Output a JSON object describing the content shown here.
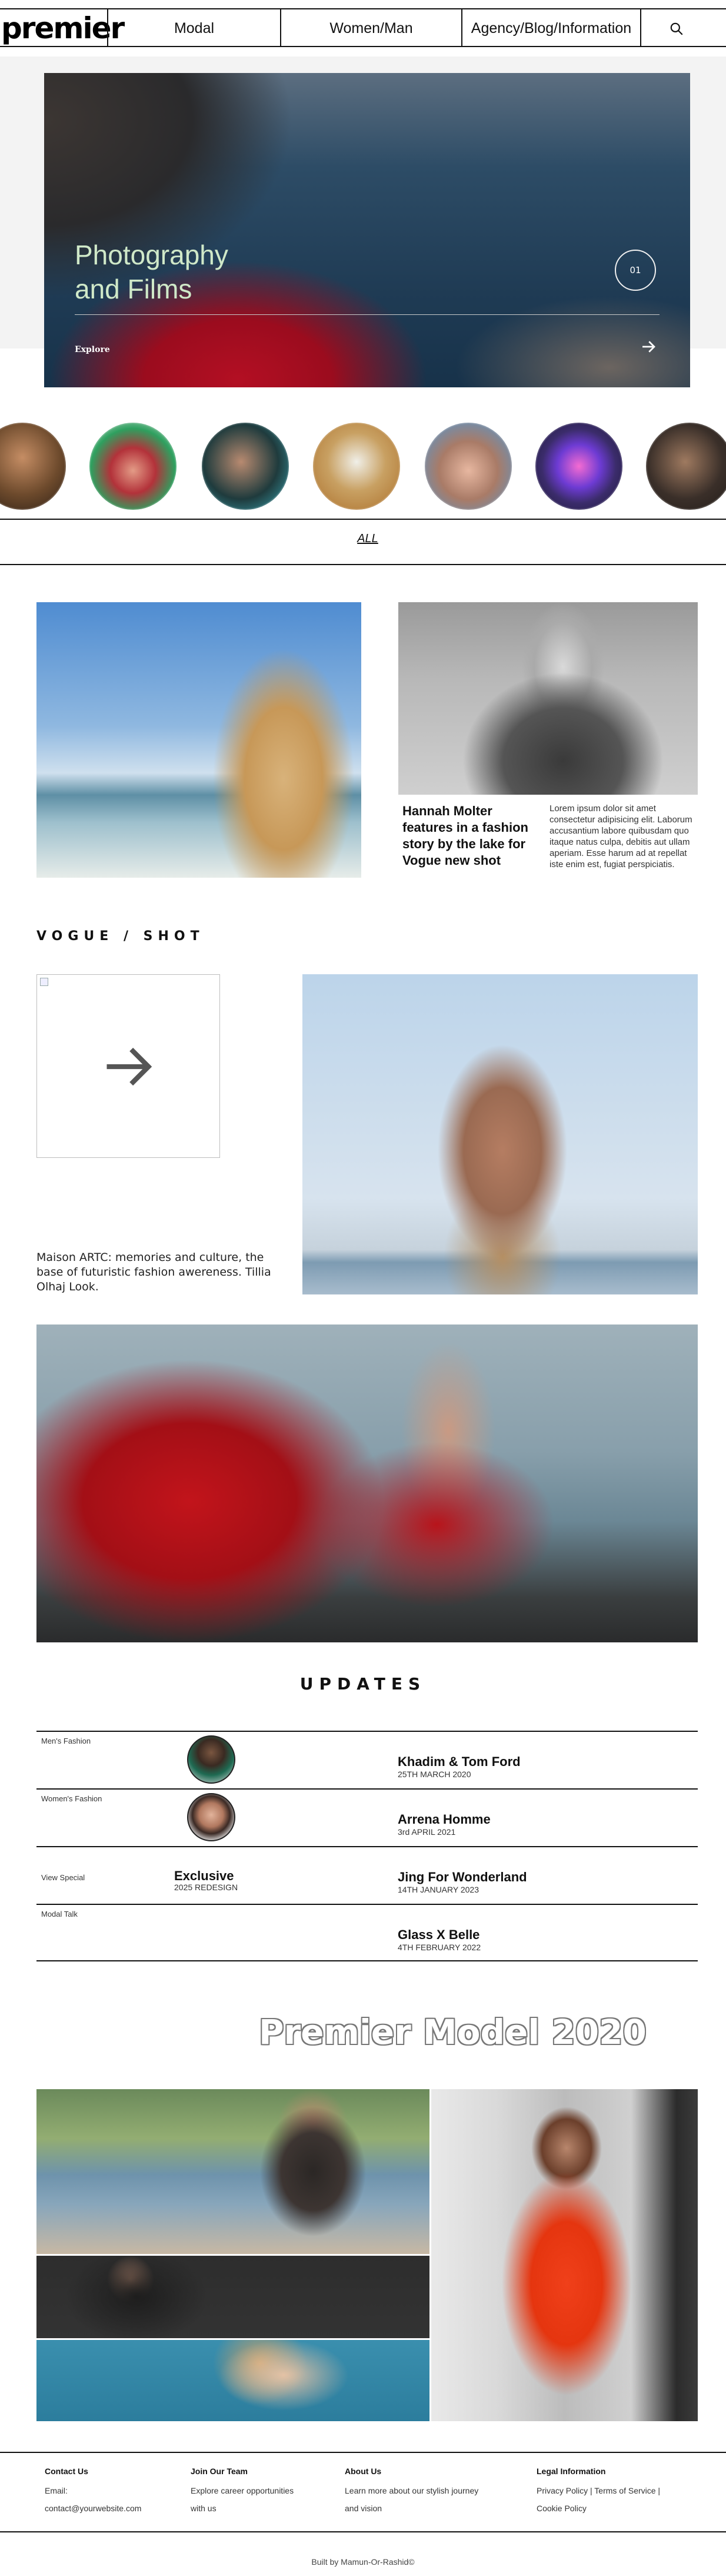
{
  "nav": {
    "logo": "premier",
    "links": [
      "Modal",
      "Women/Man",
      "Agency/Blog/Information"
    ],
    "search_icon": "search-icon"
  },
  "hero": {
    "title_line1": "Photography",
    "title_line2": "and Films",
    "counter": "01",
    "explore": "Explore",
    "arrow_icon": "arrow-right-icon"
  },
  "avatars": {
    "count": 7,
    "tones": [
      "#6d4a2c",
      "#2ea05f",
      "#2b6c73",
      "#b6813f",
      "#a97b67",
      "#3b2c6b",
      "#3a2f29"
    ]
  },
  "filter": {
    "label": "ALL"
  },
  "feature": {
    "headline": "Hannah Molter features in a fashion story by the lake for Vogue new shot",
    "body": "Lorem ipsum dolor sit amet consectetur adipisicing elit. Laborum accusantium labore quibusdam quo itaque natus culpa, debitis aut ullam aperiam. Esse harum ad at repellat iste enim est, fugiat perspiciatis."
  },
  "vogue": {
    "title": "VOGUE / SHOT",
    "caption": "Maison ARTC: memories and culture, the base of futuristic fashion awereness. Tillia Olhaj Look.",
    "arrow_icon": "arrow-right-icon"
  },
  "updates": {
    "title": "UPDATES",
    "rows": [
      {
        "category": "Men's Fashion",
        "name": "Khadim & Tom Ford",
        "date": "25TH MARCH 2020",
        "has_thumb": true,
        "mid_title": "",
        "mid_sub": ""
      },
      {
        "category": "Women's Fashion",
        "name": "Arrena Homme",
        "date": "3rd APRIL 2021",
        "has_thumb": true,
        "mid_title": "",
        "mid_sub": ""
      },
      {
        "category": "View Special",
        "name": "Jing For Wonderland",
        "date": "14TH JANUARY 2023",
        "has_thumb": false,
        "mid_title": "Exclusive",
        "mid_sub": "2025 REDESIGN"
      },
      {
        "category": "Modal Talk",
        "name": "Glass X Belle",
        "date": "4TH FEBRUARY 2022",
        "has_thumb": false,
        "mid_title": "",
        "mid_sub": ""
      }
    ]
  },
  "premier_model": {
    "title": "Premier Model 2020"
  },
  "footer": {
    "columns": [
      {
        "heading": "Contact Us",
        "lines": [
          "Email:",
          "contact@yourwebsite.com"
        ]
      },
      {
        "heading": "Join Our Team",
        "lines": [
          "Explore career opportunities",
          "with us"
        ]
      },
      {
        "heading": "About Us",
        "lines": [
          "Learn more about our stylish journey",
          "and vision"
        ]
      },
      {
        "heading": "Legal Information",
        "lines": [
          "Privacy Policy | Terms of Service |",
          "Cookie Policy"
        ]
      }
    ],
    "built_by": "Built by Mamun-Or-Rashid©"
  }
}
